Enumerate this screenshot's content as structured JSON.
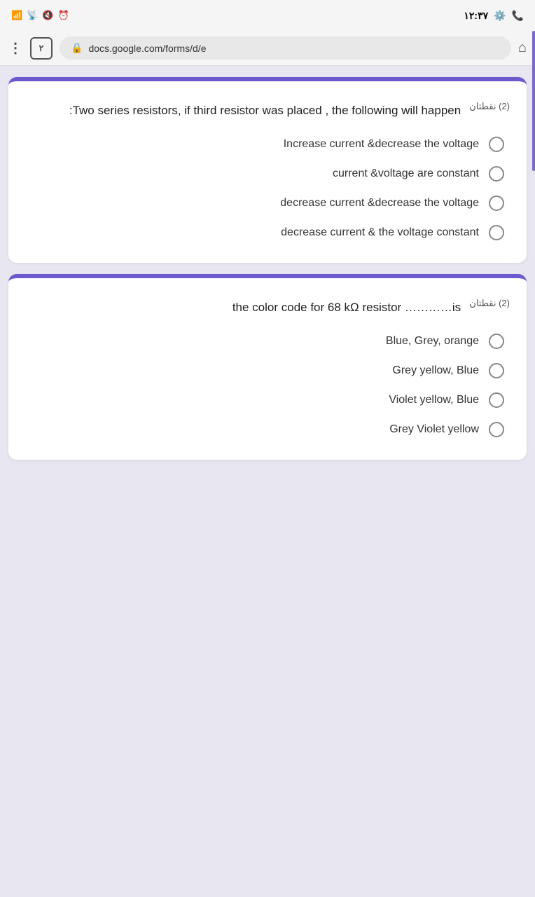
{
  "statusBar": {
    "time": "١٢:٣٧",
    "tabCount": "٢"
  },
  "browserBar": {
    "url": "docs.google.com/forms/d/e",
    "dotsLabel": "⋮",
    "homeIcon": "⌂"
  },
  "questions": [
    {
      "id": "q1",
      "points": "(2) نقطتان",
      "text": "Two series resistors, if third resistor was placed , the following will happen:",
      "options": [
        {
          "id": "q1o1",
          "label": "Increase current &decrease the voltage"
        },
        {
          "id": "q1o2",
          "label": "current &voltage are constant"
        },
        {
          "id": "q1o3",
          "label": "decrease current &decrease the voltage"
        },
        {
          "id": "q1o4",
          "label": "decrease current & the voltage constant"
        }
      ]
    },
    {
      "id": "q2",
      "points": "(2) نقطتان",
      "text": "the color code for 68 kΩ resistor …………is",
      "options": [
        {
          "id": "q2o1",
          "label": "Blue, Grey, orange"
        },
        {
          "id": "q2o2",
          "label": "Grey yellow, Blue"
        },
        {
          "id": "q2o3",
          "label": "Violet yellow, Blue"
        },
        {
          "id": "q2o4",
          "label": "Grey Violet yellow"
        }
      ]
    }
  ]
}
